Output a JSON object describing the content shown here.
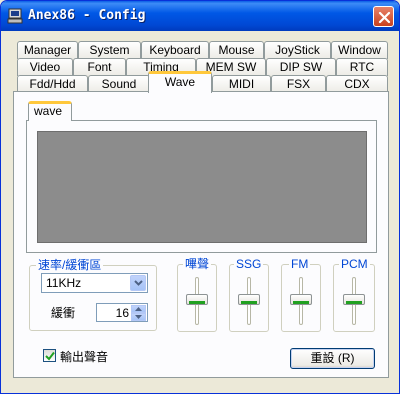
{
  "window": {
    "title": "Anex86 - Config"
  },
  "tabs": {
    "row1": [
      "Manager",
      "System",
      "Keyboard",
      "Mouse",
      "JoyStick",
      "Window"
    ],
    "row2": [
      "Video",
      "Font",
      "Timing",
      "MEM SW",
      "DIP SW",
      "RTC"
    ],
    "row3": [
      "Fdd/Hdd",
      "Sound",
      "Wave",
      "MIDI",
      "FSX",
      "CDX"
    ],
    "active": "Wave"
  },
  "inner_tab": {
    "label": "wave"
  },
  "rate_group": {
    "label": "速率/緩衝區",
    "rate_value": "11KHz",
    "buffer_label": "緩衝",
    "buffer_value": "16"
  },
  "volume_groups": [
    {
      "label": "嗶聲",
      "level": 0.5
    },
    {
      "label": "SSG",
      "level": 0.5
    },
    {
      "label": "FM",
      "level": 0.5
    },
    {
      "label": "PCM",
      "level": 0.5
    }
  ],
  "output_checkbox": {
    "label": "輸出聲音",
    "checked": true
  },
  "reset_button": {
    "label": "重設 (R)"
  },
  "colors": {
    "titlebar": "#0058e6",
    "group_label": "#0046d5",
    "tab_highlight": "#ffc83c",
    "wave_bg": "#8c8c8c"
  }
}
